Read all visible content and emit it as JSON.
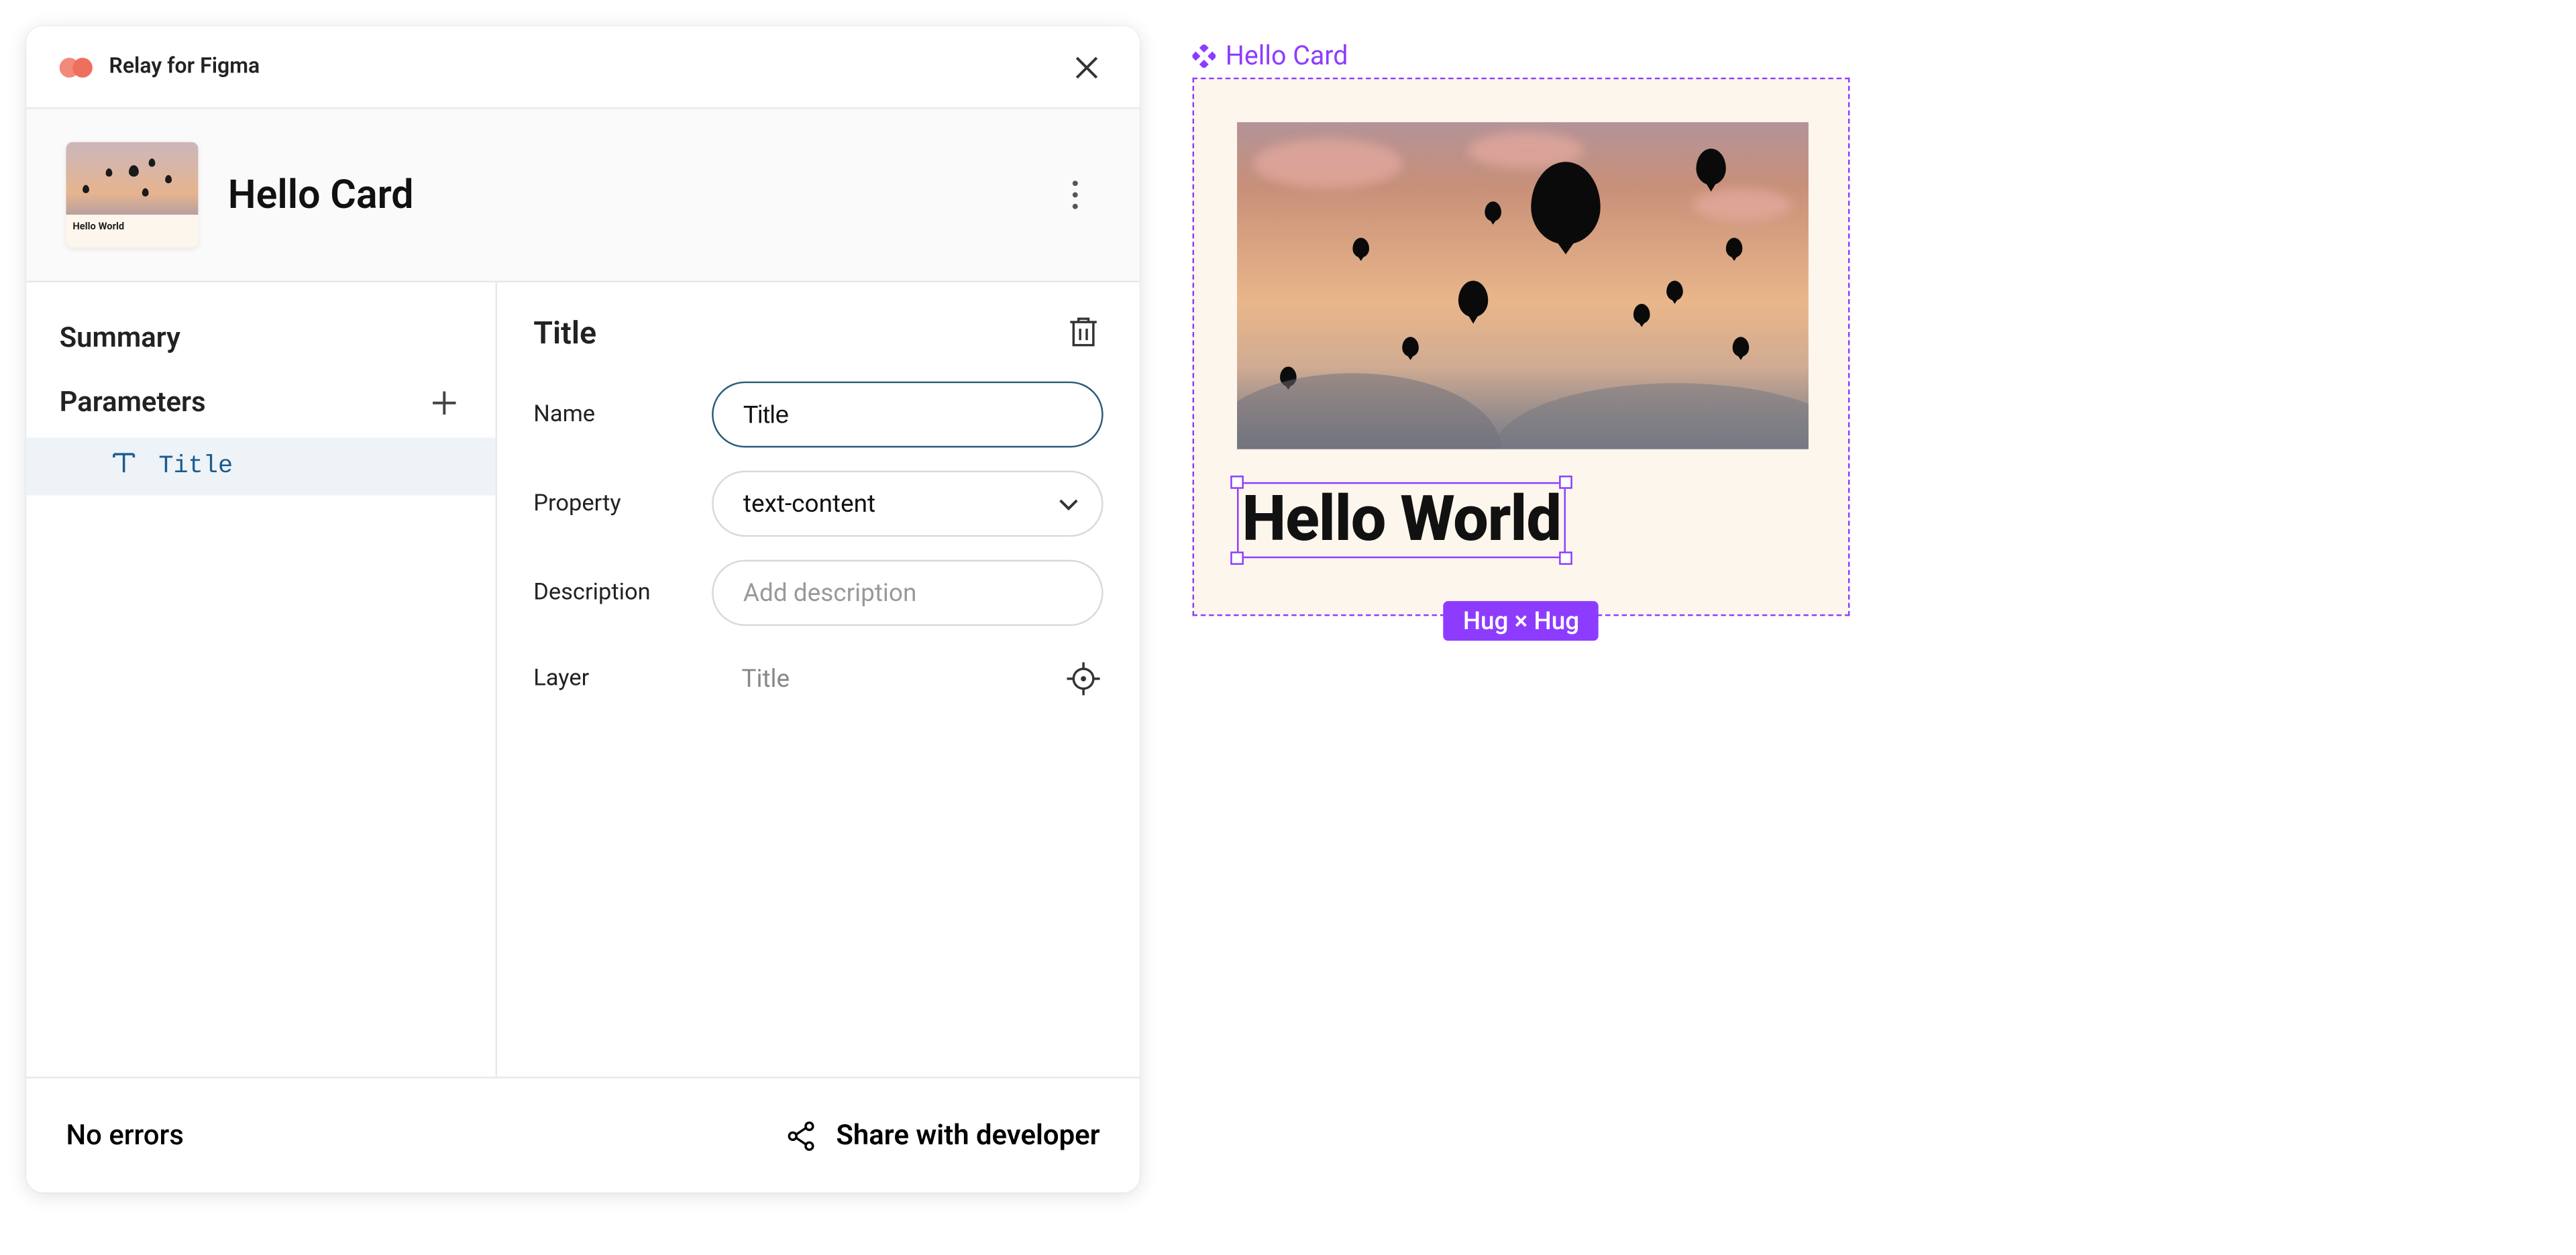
{
  "colors": {
    "accent": "#8d3cff",
    "highlight": "#eef3f8",
    "border_focus": "#2b5b77"
  },
  "plugin": {
    "name": "Relay for Figma"
  },
  "header": {
    "card_title": "Hello Card",
    "thumb_caption": "Hello World"
  },
  "sidebar": {
    "sections": {
      "summary": "Summary",
      "parameters": "Parameters"
    },
    "params": [
      {
        "icon": "T",
        "name": "Title"
      }
    ]
  },
  "details": {
    "heading": "Title",
    "fields": {
      "name_label": "Name",
      "name_value": "Title",
      "property_label": "Property",
      "property_value": "text-content",
      "description_label": "Description",
      "description_placeholder": "Add description",
      "layer_label": "Layer",
      "layer_value": "Title"
    }
  },
  "footer": {
    "status": "No errors",
    "share_label": "Share with developer"
  },
  "canvas": {
    "component_label": "Hello Card",
    "text_value": "Hello World",
    "resize_badge": "Hug × Hug"
  }
}
